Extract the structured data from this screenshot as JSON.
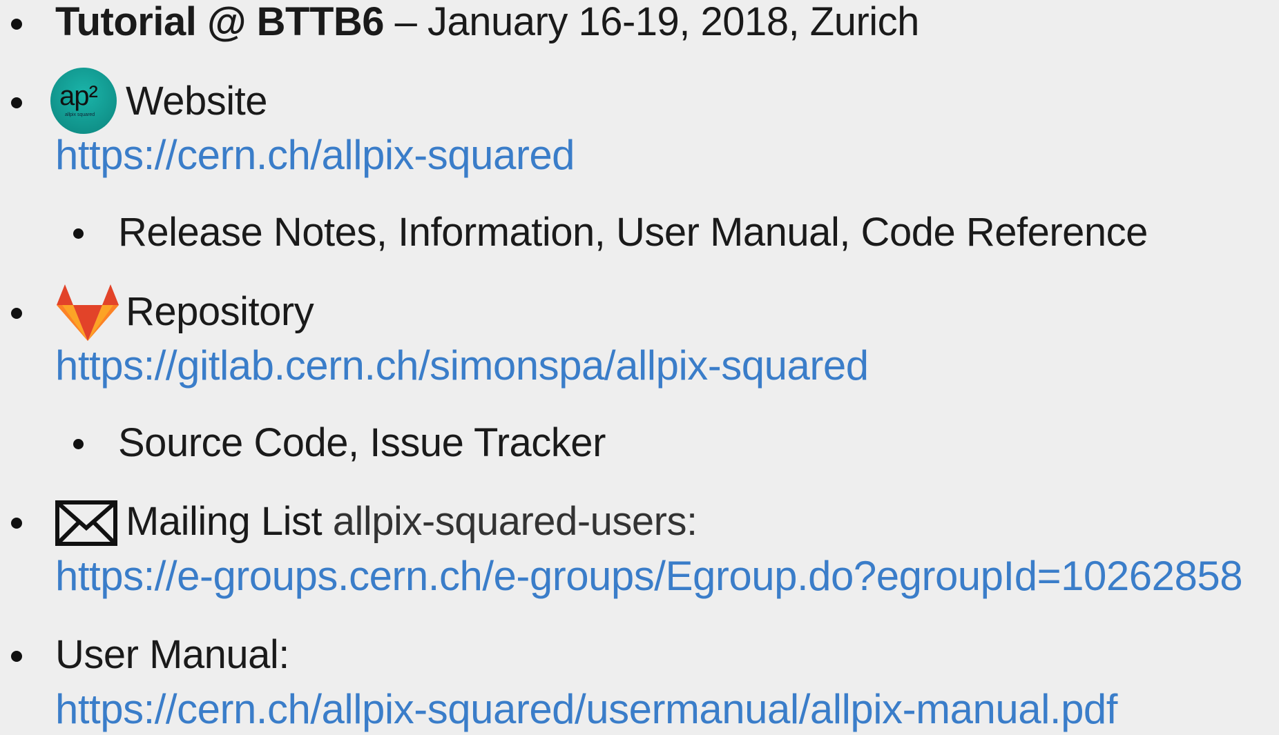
{
  "items": [
    {
      "bold_text": "Tutorial @ BTTB6",
      "rest_text": " – January 16-19, 2018, Zurich"
    },
    {
      "icon": "allpix-squared-logo-icon",
      "logo_text": "ap²",
      "logo_subtext": "allpix squared",
      "label": "Website",
      "link": "https://cern.ch/allpix-squared",
      "sub_bullets": [
        "Release Notes, Information, User Manual, Code Reference"
      ]
    },
    {
      "icon": "gitlab-icon",
      "label": "Repository",
      "link": "https://gitlab.cern.ch/simonspa/allpix-squared",
      "sub_bullets": [
        "Source Code, Issue Tracker"
      ]
    },
    {
      "icon": "envelope-icon",
      "label": "Mailing List",
      "label_suffix": " allpix-squared-users:",
      "link": "https://e-groups.cern.ch/e-groups/Egroup.do?egroupId=10262858"
    },
    {
      "label": "User Manual:",
      "link": "https://cern.ch/allpix-squared/usermanual/allpix-manual.pdf"
    }
  ],
  "colors": {
    "background": "#eeeeee",
    "text": "#1a1a1a",
    "link": "#3a7dc9",
    "logo_teal": "#14a39a",
    "gitlab_orange": "#e24329",
    "gitlab_light": "#fca326",
    "gitlab_mid": "#fc6d26"
  }
}
